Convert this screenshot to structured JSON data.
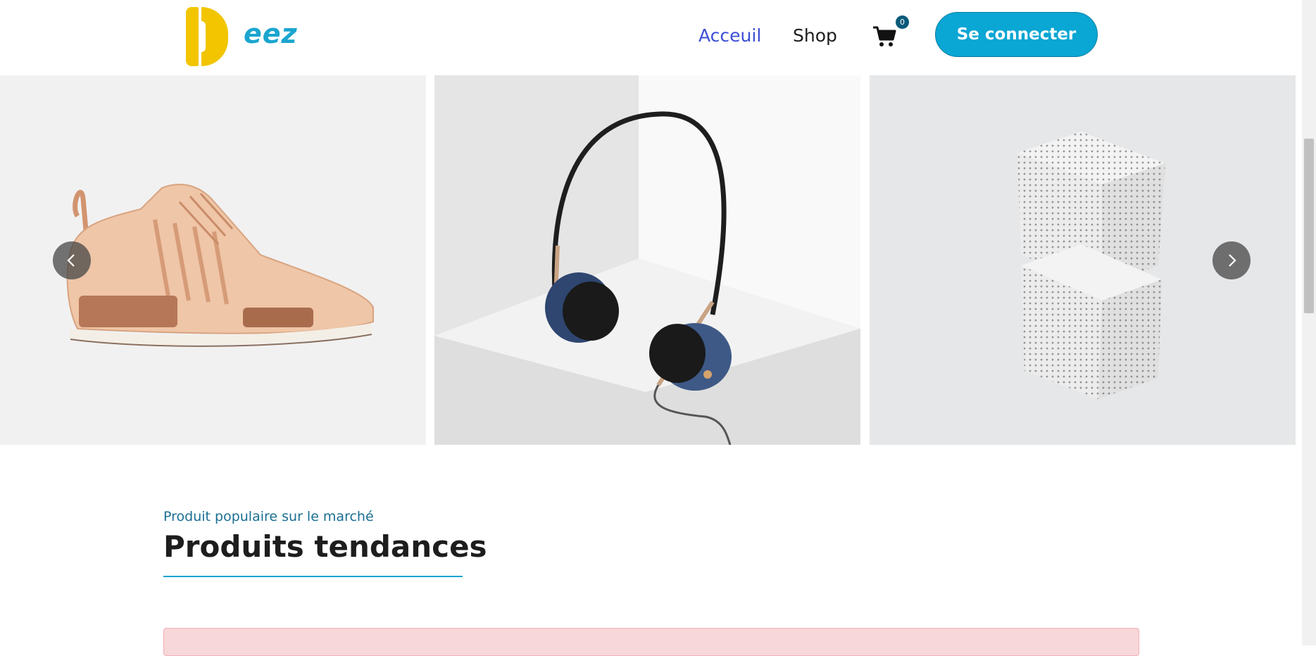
{
  "brand": {
    "logo_text": "eez"
  },
  "nav": {
    "home_label": "Acceuil",
    "shop_label": "Shop"
  },
  "cart": {
    "count": "0"
  },
  "header": {
    "login_label": "Se connecter"
  },
  "carousel": {
    "slides": [
      "sneaker",
      "headphones",
      "perforated-cubes"
    ],
    "prev_icon": "chevron-left-icon",
    "next_icon": "chevron-right-icon"
  },
  "section": {
    "subtitle": "Produit populaire sur le marché",
    "title": "Produits tendances"
  },
  "colors": {
    "accent": "#1aa5cf",
    "button": "#0aa6d4",
    "logo_yellow": "#f2c500",
    "nav_active": "#3b4fd6",
    "alert_bg": "#f8d7da"
  }
}
